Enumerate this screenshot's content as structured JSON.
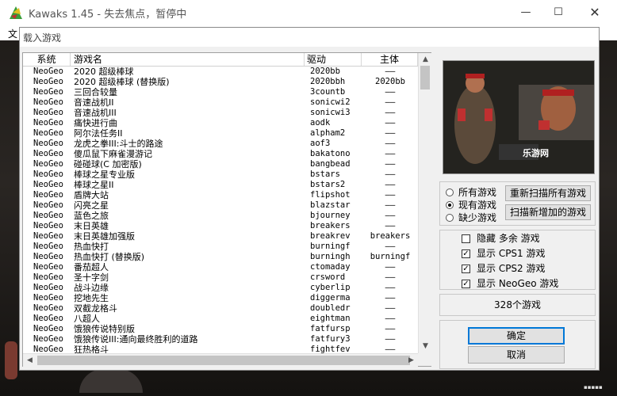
{
  "main_window": {
    "title": "Kawaks 1.45 - 失去焦点，暂停中",
    "menu_first": "文"
  },
  "dialog": {
    "title": "载入游戏",
    "columns": [
      "系统",
      "游戏名",
      "驱动",
      "主体"
    ],
    "rows": [
      [
        "NeoGeo",
        "2020 超级棒球",
        "2020bb",
        "——"
      ],
      [
        "NeoGeo",
        "2020 超级棒球 (替换版)",
        "2020bbh",
        "2020bb"
      ],
      [
        "NeoGeo",
        "三回合较量",
        "3countb",
        "——"
      ],
      [
        "NeoGeo",
        "音速战机II",
        "sonicwi2",
        "——"
      ],
      [
        "NeoGeo",
        "音速战机III",
        "sonicwi3",
        "——"
      ],
      [
        "NeoGeo",
        "痛快进行曲",
        "aodk",
        "——"
      ],
      [
        "NeoGeo",
        "阿尔法任务II",
        "alpham2",
        "——"
      ],
      [
        "NeoGeo",
        "龙虎之拳III:斗士的路途",
        "aof3",
        "——"
      ],
      [
        "NeoGeo",
        "傻瓜鼠下麻雀漫游记",
        "bakatono",
        "——"
      ],
      [
        "NeoGeo",
        "碰碰球(C 加密版)",
        "bangbead",
        "——"
      ],
      [
        "NeoGeo",
        "棒球之星专业版",
        "bstars",
        "——"
      ],
      [
        "NeoGeo",
        "棒球之星II",
        "bstars2",
        "——"
      ],
      [
        "NeoGeo",
        "盾牌大站",
        "flipshot",
        "——"
      ],
      [
        "NeoGeo",
        "闪亮之星",
        "blazstar",
        "——"
      ],
      [
        "NeoGeo",
        "蓝色之旅",
        "bjourney",
        "——"
      ],
      [
        "NeoGeo",
        "末日英雄",
        "breakers",
        "——"
      ],
      [
        "NeoGeo",
        "末日英雄加强版",
        "breakrev",
        "breakers"
      ],
      [
        "NeoGeo",
        "热血快打",
        "burningf",
        "——"
      ],
      [
        "NeoGeo",
        "热血快打 (替换版)",
        "burningh",
        "burningf"
      ],
      [
        "NeoGeo",
        "番茄超人",
        "ctomaday",
        "——"
      ],
      [
        "NeoGeo",
        "圣十字剑",
        "crsword",
        "——"
      ],
      [
        "NeoGeo",
        "战斗边缘",
        "cyberlip",
        "——"
      ],
      [
        "NeoGeo",
        "挖地先生",
        "diggerma",
        "——"
      ],
      [
        "NeoGeo",
        "双截龙格斗",
        "doubledr",
        "——"
      ],
      [
        "NeoGeo",
        "八超人",
        "eightman",
        "——"
      ],
      [
        "NeoGeo",
        "饿狼传说特别版",
        "fatfursp",
        "——"
      ],
      [
        "NeoGeo",
        "饿狼传说III:通向最终胜利的道路",
        "fatfury3",
        "——"
      ],
      [
        "NeoGeo",
        "狂热格斗",
        "fightfev",
        "——"
      ]
    ],
    "preview_caption": "乐游网",
    "filter": {
      "options": [
        "所有游戏",
        "现有游戏",
        "缺少游戏"
      ],
      "selected_index": 1,
      "rescan_all": "重新扫描所有游戏",
      "scan_new": "扫描新增加的游戏"
    },
    "checks": [
      {
        "label": "隐藏 多余 游戏",
        "checked": false
      },
      {
        "label": "显示 CPS1 游戏",
        "checked": true
      },
      {
        "label": "显示 CPS2 游戏",
        "checked": true
      },
      {
        "label": "显示 NeoGeo 游戏",
        "checked": true
      }
    ],
    "count": "328个游戏",
    "ok": "确定",
    "cancel": "取消"
  },
  "colors": {
    "focus_border": "#0078d7",
    "dialog_bg": "#f0f0f0",
    "title_text": "#555555"
  },
  "icons": [
    "kawaks-app-icon",
    "minimize-icon",
    "maximize-icon",
    "close-icon",
    "scroll-up-icon",
    "scroll-down-icon",
    "scroll-left-icon",
    "scroll-right-icon"
  ]
}
